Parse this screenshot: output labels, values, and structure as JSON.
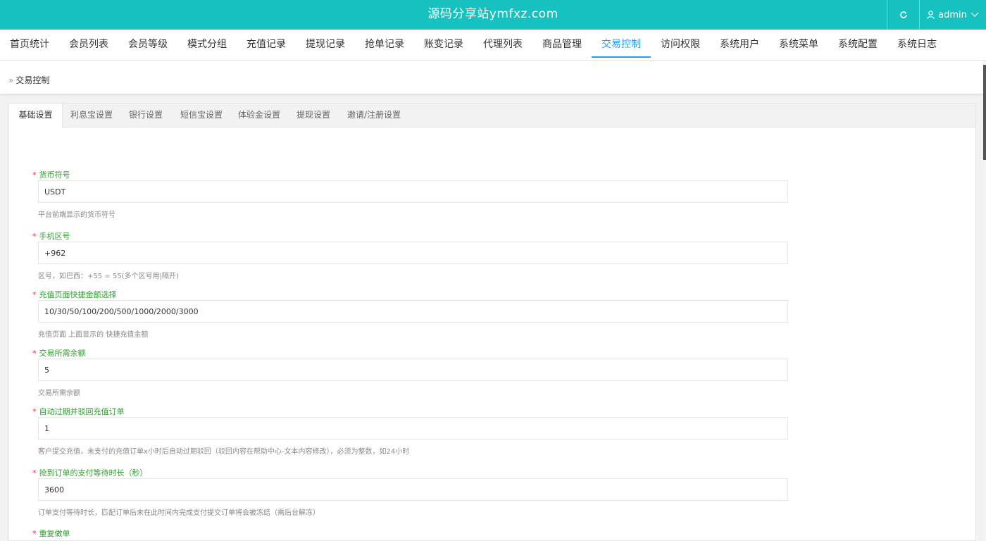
{
  "header": {
    "brand": "源码分享站ymfxz.com",
    "user": "admin",
    "refresh_icon": "refresh-icon",
    "user_icon": "user-icon",
    "accent_color": "#17c1bf"
  },
  "nav": {
    "active_color": "#1e9fff",
    "items": [
      {
        "label": "首页统计"
      },
      {
        "label": "会员列表"
      },
      {
        "label": "会员等级"
      },
      {
        "label": "模式分组"
      },
      {
        "label": "充值记录"
      },
      {
        "label": "提现记录"
      },
      {
        "label": "抢单记录"
      },
      {
        "label": "账变记录"
      },
      {
        "label": "代理列表"
      },
      {
        "label": "商品管理"
      },
      {
        "label": "交易控制"
      },
      {
        "label": "访问权限"
      },
      {
        "label": "系统用户"
      },
      {
        "label": "系统菜单"
      },
      {
        "label": "系统配置"
      },
      {
        "label": "系统日志"
      }
    ],
    "active": "交易控制"
  },
  "breadcrumb": {
    "separator": "»",
    "current": "交易控制"
  },
  "tabs": {
    "items": [
      {
        "label": "基础设置"
      },
      {
        "label": "利息宝设置"
      },
      {
        "label": "银行设置"
      },
      {
        "label": "短信宝设置"
      },
      {
        "label": "体验金设置"
      },
      {
        "label": "提现设置"
      },
      {
        "label": "邀请/注册设置"
      }
    ],
    "active": "基础设置"
  },
  "form": {
    "required_mark": "*",
    "fields": [
      {
        "label": "货币符号",
        "value": "USDT",
        "help": "平台前端显示的货币符号"
      },
      {
        "label": "手机区号",
        "value": "+962",
        "help": "区号，如巴西：+55 = 55(多个区号用|隔开)"
      },
      {
        "label": "充值页面快捷金额选择",
        "value": "10/30/50/100/200/500/1000/2000/3000",
        "help": "充值页面 上面显示的 快捷充值金额"
      },
      {
        "label": "交易所需余额",
        "value": "5",
        "help": "交易所需余额"
      },
      {
        "label": "自动过期并驳回充值订单",
        "value": "1",
        "help": "客户提交充值，未支付的充值订单x小时后自动过期驳回（驳回内容在帮助中心-文本内容修改），必须为整数，如24小时"
      },
      {
        "label": "抢到订单的支付等待时长（秒）",
        "value": "3600",
        "help": "订单支付等待时长，匹配订单后未在此时间内完成支付提交订单将会被冻结（需后台解冻）"
      },
      {
        "label": "重复做单",
        "value": "",
        "help": ""
      }
    ]
  }
}
